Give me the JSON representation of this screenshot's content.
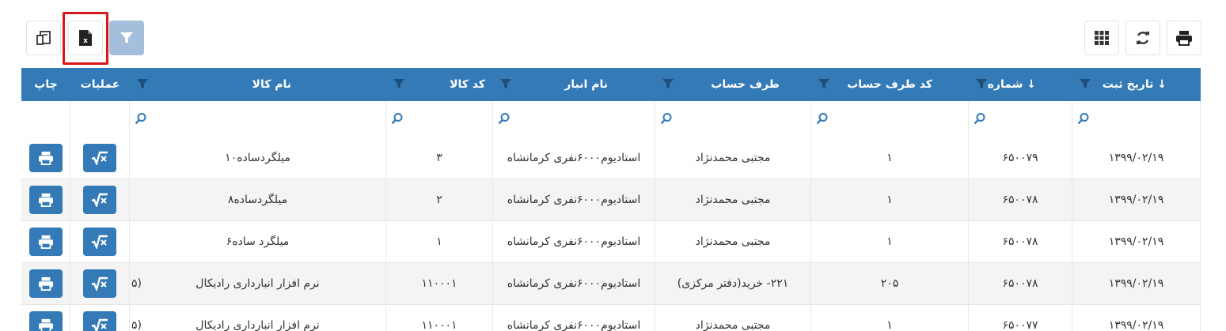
{
  "toolbar": {
    "left_buttons": [
      {
        "name": "columns-chooser",
        "icon": "columns-chooser-icon"
      },
      {
        "name": "excel-export",
        "icon": "excel-file-icon"
      },
      {
        "name": "filter-toggle",
        "icon": "filter-icon"
      }
    ],
    "right_buttons": [
      {
        "name": "column-grid",
        "icon": "grid-icon"
      },
      {
        "name": "refresh",
        "icon": "refresh-icon"
      },
      {
        "name": "print",
        "icon": "printer-icon"
      }
    ]
  },
  "colors": {
    "header_bg": "#337ab7",
    "filter_active_bg": "#a4bedb",
    "highlight_border": "#d81818",
    "action_button": "#337ab7"
  },
  "table": {
    "columns": {
      "date": "تاریخ ثبت ↓",
      "number": "شماره ↓",
      "account_code": "کد طرف حساب",
      "account": "طرف حساب",
      "warehouse": "نام انبار",
      "item_code": "کد کالا",
      "item_name": "نام کالا",
      "operations": "عملیات",
      "print": "چاپ"
    },
    "rows": [
      {
        "date": "۱۳۹۹/۰۲/۱۹",
        "number": "۶۵۰۰۷۹",
        "account_code": "۱",
        "account": "مجتبی محمدنژاد",
        "warehouse": "استادیوم۶۰۰۰نفری کرمانشاه",
        "item_code": "۳",
        "item_name": "میلگردساده۱۰",
        "extra": ""
      },
      {
        "date": "۱۳۹۹/۰۲/۱۹",
        "number": "۶۵۰۰۷۸",
        "account_code": "۱",
        "account": "مجتبی محمدنژاد",
        "warehouse": "استادیوم۶۰۰۰نفری کرمانشاه",
        "item_code": "۲",
        "item_name": "میلگردساده۸",
        "extra": ""
      },
      {
        "date": "۱۳۹۹/۰۲/۱۹",
        "number": "۶۵۰۰۷۸",
        "account_code": "۱",
        "account": "مجتبی محمدنژاد",
        "warehouse": "استادیوم۶۰۰۰نفری کرمانشاه",
        "item_code": "۱",
        "item_name": "میلگرد ساده۶",
        "extra": ""
      },
      {
        "date": "۱۳۹۹/۰۲/۱۹",
        "number": "۶۵۰۰۷۸",
        "account_code": "۲۰۵",
        "account": "۲۲۱- خرید(دفتر مرکزی)",
        "warehouse": "استادیوم۶۰۰۰نفری کرمانشاه",
        "item_code": "۱۱۰۰۰۱",
        "item_name": "نرم افزار انبارداری رادیکال",
        "extra": "(۵"
      },
      {
        "date": "۱۳۹۹/۰۲/۱۹",
        "number": "۶۵۰۰۷۷",
        "account_code": "۱",
        "account": "مجتبی محمدنژاد",
        "warehouse": "استادیوم۶۰۰۰نفری کرمانشاه",
        "item_code": "۱۱۰۰۰۱",
        "item_name": "نرم افزار انبارداری رادیکال",
        "extra": "(۵"
      }
    ]
  }
}
